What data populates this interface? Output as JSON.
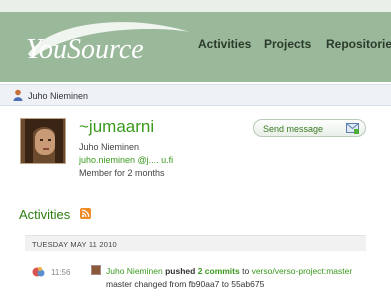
{
  "header": {
    "logo_text": "YouSource",
    "nav": [
      "Activities",
      "Projects",
      "Repositories"
    ]
  },
  "breadcrumb": {
    "label": "Juho Nieminen"
  },
  "profile": {
    "login": "~jumaarni",
    "full_name": "Juho Nieminen",
    "email": "juho.nieminen @j.... u.fi",
    "member_since": "Member for 2 months",
    "send_message_label": "Send message"
  },
  "activities": {
    "heading": "Activities",
    "date": "TUESDAY MAY 11 2010",
    "events": [
      {
        "time": "11:56",
        "user": "Juho Nieminen",
        "action": "pushed",
        "commits": "2 commits",
        "to_word": "to",
        "target": "verso/verso-project:master",
        "detail": "master changed from fb90aa7 to 55ab675"
      }
    ]
  },
  "colors": {
    "header_bg": "#9ab89a",
    "link_green": "#3a9a1e",
    "breadcrumb_bg": "#eef2f6"
  }
}
